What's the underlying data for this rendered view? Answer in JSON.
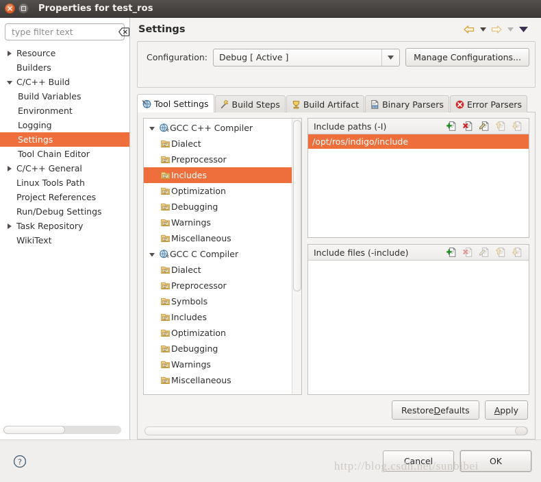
{
  "window": {
    "title": "Properties for test_ros",
    "close_icon": "close-icon",
    "maximize_icon": "maximize-icon"
  },
  "filter": {
    "placeholder": "type filter text",
    "value": "",
    "clear_icon": "clear-text-icon"
  },
  "sidebar": {
    "items": [
      {
        "label": "Resource",
        "depth": 1,
        "arrow": "collapsed",
        "selected": false
      },
      {
        "label": "Builders",
        "depth": 1,
        "arrow": "none",
        "selected": false
      },
      {
        "label": "C/C++ Build",
        "depth": 1,
        "arrow": "expanded",
        "selected": false
      },
      {
        "label": "Build Variables",
        "depth": 2,
        "arrow": "none",
        "selected": false
      },
      {
        "label": "Environment",
        "depth": 2,
        "arrow": "none",
        "selected": false
      },
      {
        "label": "Logging",
        "depth": 2,
        "arrow": "none",
        "selected": false
      },
      {
        "label": "Settings",
        "depth": 2,
        "arrow": "none",
        "selected": true
      },
      {
        "label": "Tool Chain Editor",
        "depth": 2,
        "arrow": "none",
        "selected": false
      },
      {
        "label": "C/C++ General",
        "depth": 1,
        "arrow": "collapsed",
        "selected": false
      },
      {
        "label": "Linux Tools Path",
        "depth": 1,
        "arrow": "none",
        "selected": false
      },
      {
        "label": "Project References",
        "depth": 1,
        "arrow": "none",
        "selected": false
      },
      {
        "label": "Run/Debug Settings",
        "depth": 1,
        "arrow": "none",
        "selected": false
      },
      {
        "label": "Task Repository",
        "depth": 1,
        "arrow": "collapsed",
        "selected": false
      },
      {
        "label": "WikiText",
        "depth": 1,
        "arrow": "none",
        "selected": false
      }
    ]
  },
  "page": {
    "title": "Settings",
    "nav": {
      "back_icon": "back-arrow-icon",
      "back_menu_icon": "chevron-down-icon",
      "forward_icon": "forward-arrow-icon",
      "forward_menu_icon": "chevron-down-icon",
      "menu_icon": "view-menu-icon"
    }
  },
  "configuration": {
    "label": "Configuration:",
    "value": "Debug  [ Active ]",
    "dropdown_icon": "chevron-down-icon",
    "manage_button": "Manage Configurations..."
  },
  "tabs": [
    {
      "label": "Tool Settings",
      "icon": "tool-settings-icon",
      "active": true
    },
    {
      "label": "Build Steps",
      "icon": "build-steps-icon",
      "active": false
    },
    {
      "label": "Build Artifact",
      "icon": "build-artifact-icon",
      "active": false
    },
    {
      "label": "Binary Parsers",
      "icon": "binary-parsers-icon",
      "active": false
    },
    {
      "label": "Error Parsers",
      "icon": "error-parsers-icon",
      "active": false
    }
  ],
  "tool_tree": [
    {
      "label": "GCC C++ Compiler",
      "type": "root",
      "arrow": "expanded",
      "icon": "compiler-icon",
      "selected": false
    },
    {
      "label": "Dialect",
      "type": "child",
      "arrow": "none",
      "icon": "option-folder-icon",
      "selected": false
    },
    {
      "label": "Preprocessor",
      "type": "child",
      "arrow": "none",
      "icon": "option-folder-icon",
      "selected": false
    },
    {
      "label": "Includes",
      "type": "child",
      "arrow": "none",
      "icon": "option-folder-icon",
      "selected": true
    },
    {
      "label": "Optimization",
      "type": "child",
      "arrow": "none",
      "icon": "option-folder-icon",
      "selected": false
    },
    {
      "label": "Debugging",
      "type": "child",
      "arrow": "none",
      "icon": "option-folder-icon",
      "selected": false
    },
    {
      "label": "Warnings",
      "type": "child",
      "arrow": "none",
      "icon": "option-folder-icon",
      "selected": false
    },
    {
      "label": "Miscellaneous",
      "type": "child",
      "arrow": "none",
      "icon": "option-folder-icon",
      "selected": false
    },
    {
      "label": "GCC C Compiler",
      "type": "root",
      "arrow": "expanded",
      "icon": "compiler-icon",
      "selected": false
    },
    {
      "label": "Dialect",
      "type": "child",
      "arrow": "none",
      "icon": "option-folder-icon",
      "selected": false
    },
    {
      "label": "Preprocessor",
      "type": "child",
      "arrow": "none",
      "icon": "option-folder-icon",
      "selected": false
    },
    {
      "label": "Symbols",
      "type": "child",
      "arrow": "none",
      "icon": "option-folder-icon",
      "selected": false
    },
    {
      "label": "Includes",
      "type": "child",
      "arrow": "none",
      "icon": "option-folder-icon",
      "selected": false
    },
    {
      "label": "Optimization",
      "type": "child",
      "arrow": "none",
      "icon": "option-folder-icon",
      "selected": false
    },
    {
      "label": "Debugging",
      "type": "child",
      "arrow": "none",
      "icon": "option-folder-icon",
      "selected": false
    },
    {
      "label": "Warnings",
      "type": "child",
      "arrow": "none",
      "icon": "option-folder-icon",
      "selected": false
    },
    {
      "label": "Miscellaneous",
      "type": "child",
      "arrow": "none",
      "icon": "option-folder-icon",
      "selected": false
    }
  ],
  "include_paths": {
    "title": "Include paths (-I)",
    "tools": [
      {
        "name": "add-icon",
        "disabled": false
      },
      {
        "name": "delete-icon",
        "disabled": false
      },
      {
        "name": "edit-icon",
        "disabled": false
      },
      {
        "name": "move-up-icon",
        "disabled": true
      },
      {
        "name": "move-down-icon",
        "disabled": true
      }
    ],
    "rows": [
      {
        "value": "/opt/ros/indigo/include",
        "selected": true
      }
    ]
  },
  "include_files": {
    "title": "Include files (-include)",
    "tools": [
      {
        "name": "add-icon",
        "disabled": false
      },
      {
        "name": "delete-icon",
        "disabled": true
      },
      {
        "name": "edit-icon",
        "disabled": true
      },
      {
        "name": "move-up-icon",
        "disabled": true
      },
      {
        "name": "move-down-icon",
        "disabled": true
      }
    ],
    "rows": []
  },
  "panel_actions": {
    "restore_defaults": {
      "before": "Restore ",
      "mnemonic": "D",
      "after": "efaults"
    },
    "apply": {
      "before": "",
      "mnemonic": "A",
      "after": "pply"
    }
  },
  "footer": {
    "help_icon": "help-icon",
    "cancel": "Cancel",
    "ok": "OK",
    "watermark": "http://blog.csdn.net/sunbibei"
  },
  "colors": {
    "selection_orange": "#ef6f3c",
    "titlebar_dark": "#474341",
    "close_orange": "#e0632b",
    "panel_bg": "#f4f3f2"
  }
}
